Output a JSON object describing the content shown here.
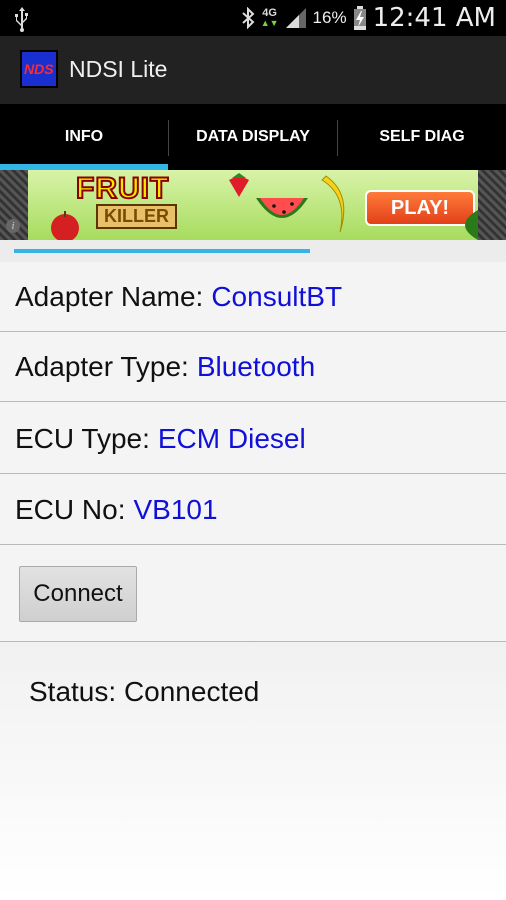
{
  "status_bar": {
    "icons": [
      "usb-icon",
      "bluetooth-icon",
      "network-4g-icon",
      "signal-icon",
      "battery-charging-icon"
    ],
    "network_type": "4G",
    "battery_percent": "16%",
    "time": "12:41 AM"
  },
  "action_bar": {
    "app_title": "NDSI Lite",
    "app_icon_text": "NDS"
  },
  "tabs": [
    {
      "label": "INFO",
      "selected": true
    },
    {
      "label": "DATA DISPLAY",
      "selected": false
    },
    {
      "label": "SELF DIAG",
      "selected": false
    }
  ],
  "ad": {
    "title_line1": "FRUIT",
    "title_line2": "KILLER",
    "button": "PLAY!",
    "info_glyph": "i"
  },
  "loading_progress": 0.62,
  "info": {
    "adapter_name": {
      "label": "Adapter Name:",
      "value": "ConsultBT"
    },
    "adapter_type": {
      "label": "Adapter Type:",
      "value": "Bluetooth"
    },
    "ecu_type": {
      "label": "ECU Type:",
      "value": "ECM Diesel"
    },
    "ecu_no": {
      "label": "ECU No:",
      "value": "VB101"
    }
  },
  "connect_button": "Connect",
  "status": "Status: Connected",
  "colors": {
    "accent": "#33b5e5",
    "value_text": "#1010d8",
    "action_bar": "#222222",
    "tab_bar": "#000000"
  }
}
